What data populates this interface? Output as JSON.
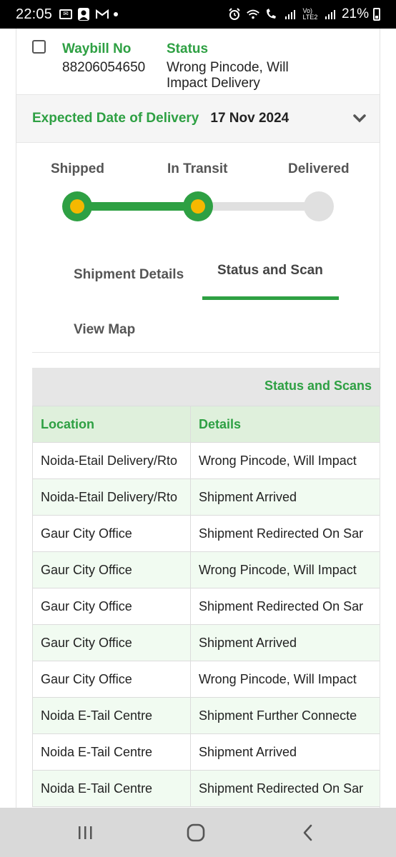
{
  "status_bar": {
    "time": "22:05",
    "battery": "21%",
    "notification_icons": [
      "email-icon",
      "profile-icon",
      "gmail-icon"
    ],
    "system_icons": [
      "alarm-icon",
      "wifi-icon",
      "wifi-calling-icon",
      "signal-icon",
      "volte-icon",
      "signal-icon"
    ]
  },
  "waybill": {
    "waybill_label": "Waybill No",
    "waybill_number": "88206054650",
    "status_label": "Status",
    "status_line1": "Wrong Pincode, Will",
    "status_line2": "Impact Delivery"
  },
  "edd": {
    "label": "Expected Date of Delivery",
    "date": "17 Nov 2024"
  },
  "progress": {
    "steps": [
      "Shipped",
      "In Transit",
      "Delivered"
    ],
    "completed_steps": 2,
    "colors": {
      "active": "#2ea043",
      "dot_center": "#f5b800",
      "inactive": "#e0e0e0"
    }
  },
  "tabs": {
    "shipment_details": "Shipment Details",
    "status_and_scan": "Status and Scan",
    "view_map": "View Map",
    "active": "status_and_scan"
  },
  "table": {
    "caption": "Status and Scans",
    "headers": {
      "location": "Location",
      "details": "Details"
    },
    "rows": [
      {
        "location": "Noida-Etail Delivery/Rto",
        "details": "Wrong Pincode, Will Impact"
      },
      {
        "location": "Noida-Etail Delivery/Rto",
        "details": "Shipment Arrived"
      },
      {
        "location": "Gaur City Office",
        "details": "Shipment Redirected On Sar"
      },
      {
        "location": "Gaur City Office",
        "details": "Wrong Pincode, Will Impact"
      },
      {
        "location": "Gaur City Office",
        "details": "Shipment Redirected On Sar"
      },
      {
        "location": "Gaur City Office",
        "details": "Shipment Arrived"
      },
      {
        "location": "Gaur City Office",
        "details": "Wrong Pincode, Will Impact"
      },
      {
        "location": "Noida E-Tail Centre",
        "details": "Shipment Further Connecte"
      },
      {
        "location": "Noida E-Tail Centre",
        "details": "Shipment Arrived"
      },
      {
        "location": "Noida E-Tail Centre",
        "details": "Shipment Redirected On Sar"
      }
    ]
  },
  "navbar": {
    "buttons": [
      "recent-apps-icon",
      "home-icon",
      "back-icon"
    ]
  }
}
